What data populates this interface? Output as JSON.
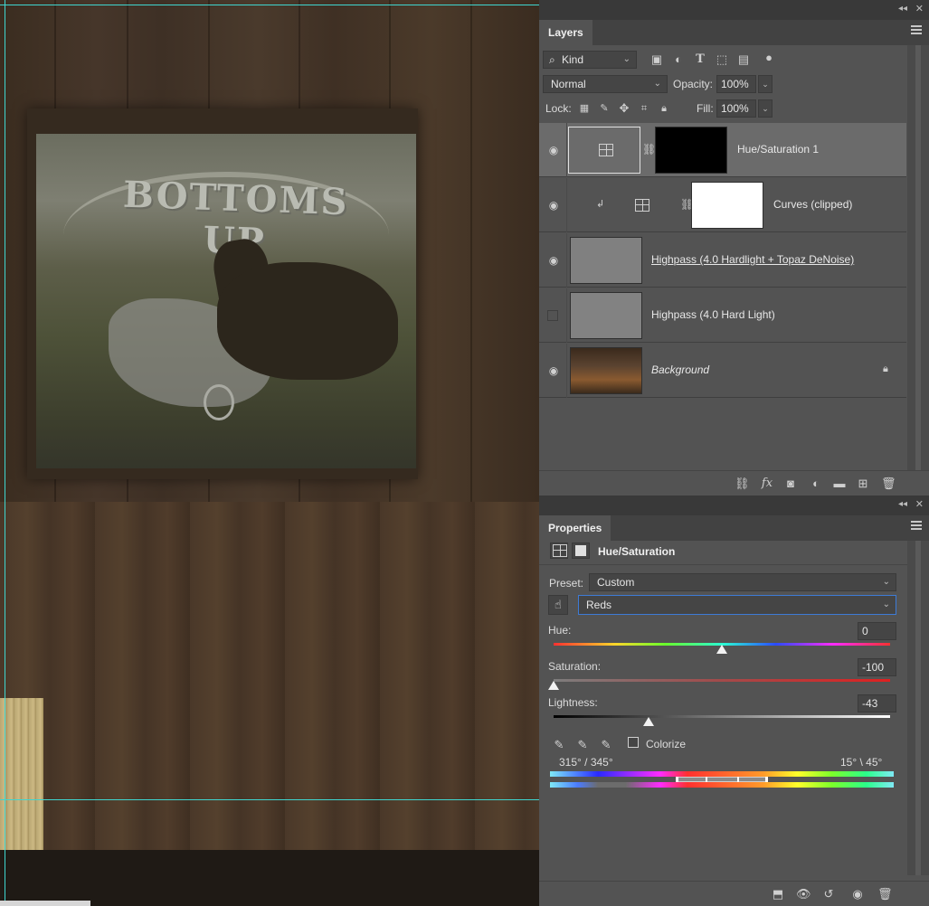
{
  "layers_panel": {
    "tab_label": "Layers",
    "filter_kind": "Kind",
    "blend_mode": "Normal",
    "opacity_label": "Opacity:",
    "opacity_value": "100%",
    "lock_label": "Lock:",
    "fill_label": "Fill:",
    "fill_value": "100%",
    "layers": [
      {
        "name": "Hue/Saturation 1",
        "visible": true,
        "selected": true
      },
      {
        "name": "Curves (clipped)",
        "visible": true,
        "selected": false
      },
      {
        "name": "Highpass (4.0 Hardlight + Topaz DeNoise)",
        "visible": true,
        "selected": false
      },
      {
        "name": "Highpass (4.0 Hard Light)",
        "visible": false,
        "selected": false
      },
      {
        "name": "Background",
        "visible": true,
        "selected": false,
        "locked": true
      }
    ]
  },
  "properties_panel": {
    "tab_label": "Properties",
    "adjustment_title": "Hue/Saturation",
    "preset_label": "Preset:",
    "preset_value": "Custom",
    "channel_value": "Reds",
    "hue_label": "Hue:",
    "hue_value": "0",
    "saturation_label": "Saturation:",
    "saturation_value": "-100",
    "lightness_label": "Lightness:",
    "lightness_value": "-43",
    "colorize_label": "Colorize",
    "colorize_checked": false,
    "range_left": "315° / 345°",
    "range_right": "15° \\ 45°"
  },
  "canvas": {
    "poster_text": "BOTTOMS UP"
  }
}
